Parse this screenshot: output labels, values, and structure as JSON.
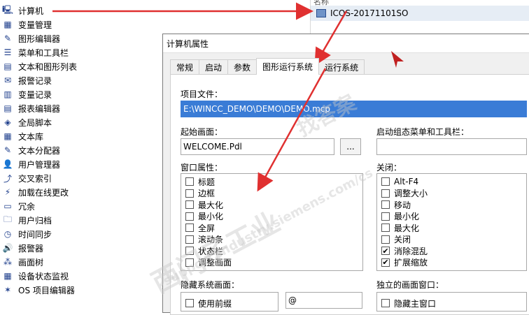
{
  "tree": {
    "items": [
      {
        "label": "计算机",
        "icon": "computer-icon"
      },
      {
        "label": "变量管理",
        "icon": "tag-management-icon"
      },
      {
        "label": "图形编辑器",
        "icon": "graphics-designer-icon"
      },
      {
        "label": "菜单和工具栏",
        "icon": "menu-toolbar-icon"
      },
      {
        "label": "文本和图形列表",
        "icon": "text-graphic-list-icon"
      },
      {
        "label": "报警记录",
        "icon": "alarm-logging-icon"
      },
      {
        "label": "变量记录",
        "icon": "tag-logging-icon"
      },
      {
        "label": "报表编辑器",
        "icon": "report-designer-icon"
      },
      {
        "label": "全局脚本",
        "icon": "global-script-icon"
      },
      {
        "label": "文本库",
        "icon": "text-library-icon"
      },
      {
        "label": "文本分配器",
        "icon": "text-distributor-icon"
      },
      {
        "label": "用户管理器",
        "icon": "user-administrator-icon"
      },
      {
        "label": "交叉索引",
        "icon": "cross-reference-icon"
      },
      {
        "label": "加载在线更改",
        "icon": "load-online-changes-icon"
      },
      {
        "label": "冗余",
        "icon": "redundancy-icon"
      },
      {
        "label": "用户归档",
        "icon": "user-archive-icon"
      },
      {
        "label": "时间同步",
        "icon": "time-sync-icon"
      },
      {
        "label": "报警器",
        "icon": "horn-icon"
      },
      {
        "label": "画面树",
        "icon": "picture-tree-icon"
      },
      {
        "label": "设备状态监视",
        "icon": "device-status-icon"
      },
      {
        "label": "OS 项目编辑器",
        "icon": "os-project-editor-icon"
      }
    ]
  },
  "right_panel": {
    "header": "名称",
    "computer_name": "ICOS-20171101SO"
  },
  "dialog": {
    "title": "计算机属性",
    "tabs": [
      "常规",
      "启动",
      "参数",
      "图形运行系统",
      "运行系统"
    ],
    "active_tab": "图形运行系统",
    "project_file_label": "项目文件：",
    "project_file_value": "E:\\WINCC_DEMO\\DEMO\\DEMO.mcp",
    "start_picture_label": "起始画面：",
    "start_picture_value": "WELCOME.Pdl",
    "browse_label": "...",
    "start_menu_label": "启动组态菜单和工具栏：",
    "start_menu_value": "",
    "window_attr_label": "窗口属性：",
    "window_attr_items": [
      {
        "label": "标题",
        "checked": false
      },
      {
        "label": "边框",
        "checked": false
      },
      {
        "label": "最大化",
        "checked": false
      },
      {
        "label": "最小化",
        "checked": false
      },
      {
        "label": "全屏",
        "checked": false
      },
      {
        "label": "滚动条",
        "checked": false
      },
      {
        "label": "状态栏",
        "checked": false
      },
      {
        "label": "调整画面",
        "checked": false
      }
    ],
    "close_label": "关闭：",
    "close_items": [
      {
        "label": "Alt-F4",
        "checked": false
      },
      {
        "label": "调整大小",
        "checked": false
      },
      {
        "label": "移动",
        "checked": false
      },
      {
        "label": "最小化",
        "checked": false
      },
      {
        "label": "最大化",
        "checked": false
      },
      {
        "label": "关闭",
        "checked": false
      },
      {
        "label": "消除混乱",
        "checked": true
      },
      {
        "label": "扩展缩放",
        "checked": true
      }
    ],
    "hide_system_label": "隐藏系统画面：",
    "use_prefix_label": "使用前缀",
    "prefix_value": "@",
    "independent_window_label": "独立的画面窗口：",
    "hide_main_window_label": "隐藏主窗口",
    "check_mark": "✔"
  },
  "watermark": {
    "line1": "西门子工业",
    "line2": "support.industry.siemens.com/cs",
    "line3": "找答案"
  },
  "colors": {
    "arrow": "#e03030",
    "selection": "#3a7cd6"
  }
}
